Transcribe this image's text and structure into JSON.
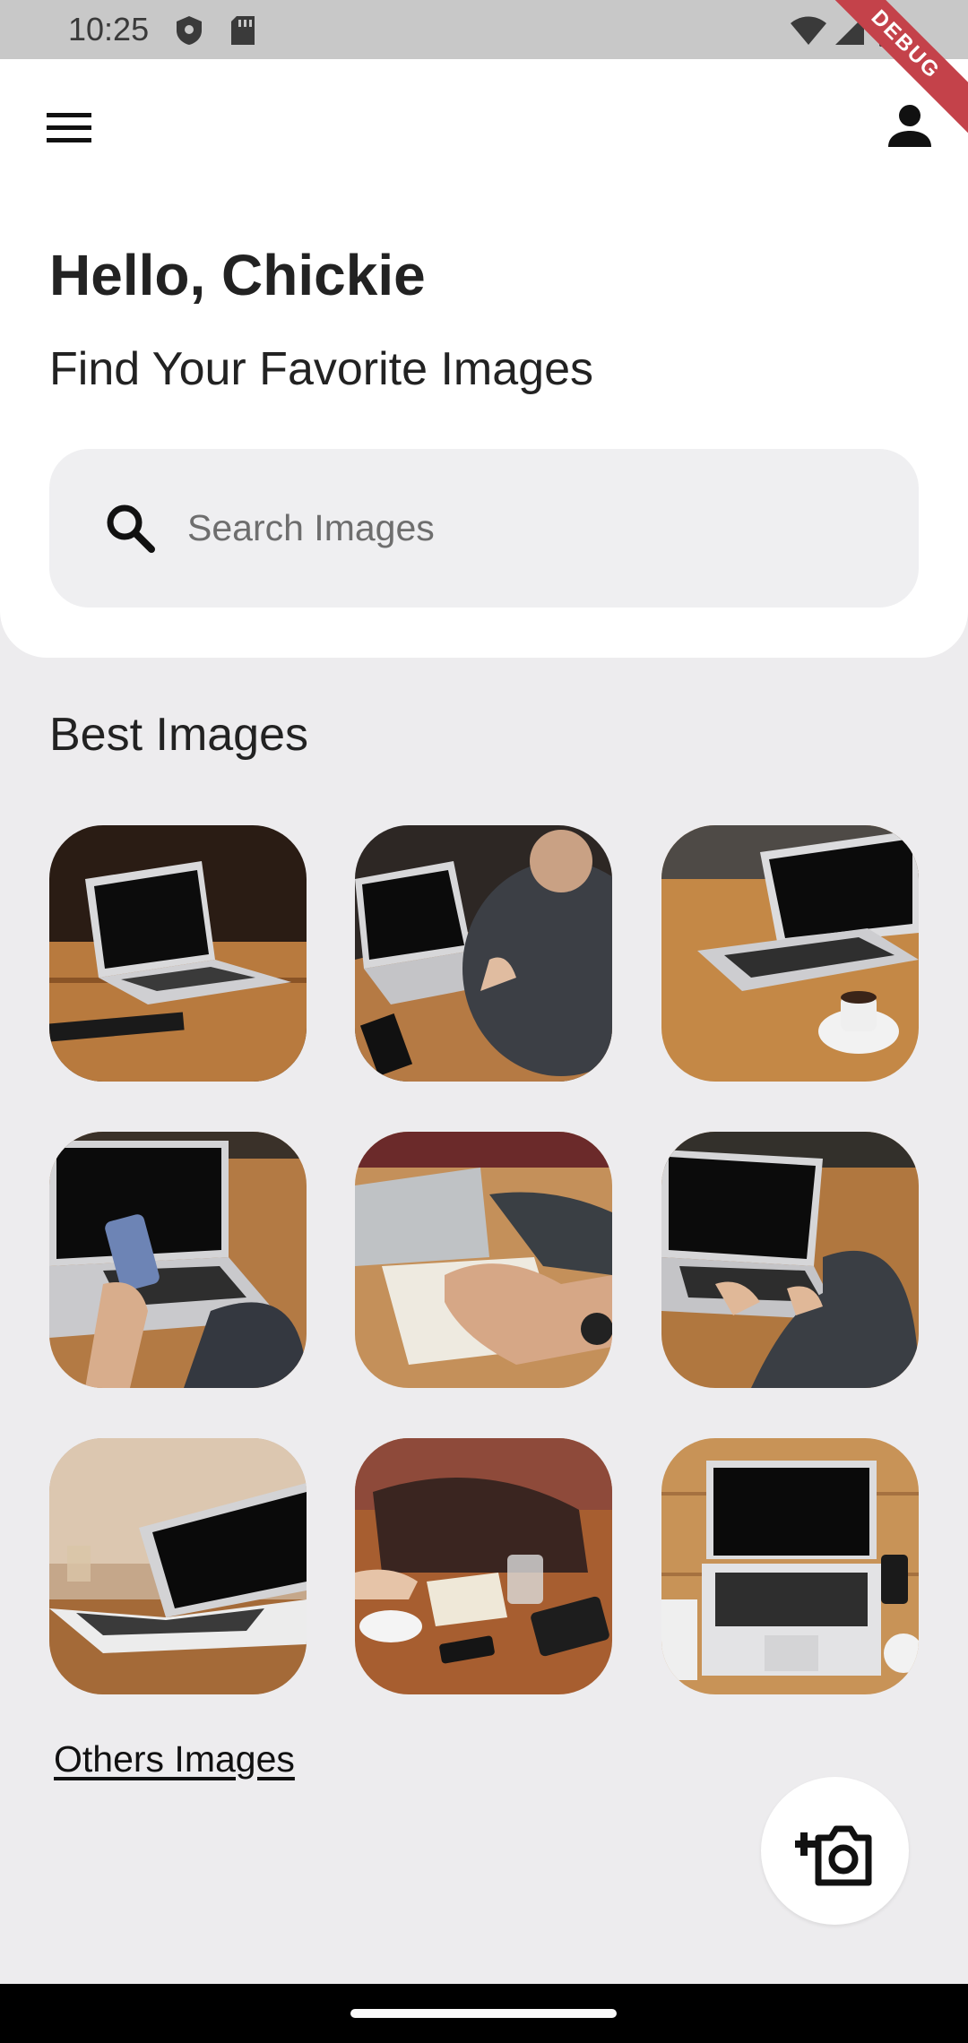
{
  "status_bar": {
    "time": "10:25",
    "debug_label": "DEBUG"
  },
  "header": {
    "greeting": "Hello, Chickie",
    "subtitle": "Find Your Favorite Images"
  },
  "search": {
    "placeholder": "Search Images",
    "value": ""
  },
  "best_images": {
    "title": "Best Images",
    "items": [
      {
        "name": "laptop-on-table"
      },
      {
        "name": "person-typing-laptop"
      },
      {
        "name": "laptop-with-coffee"
      },
      {
        "name": "hands-phone-laptop"
      },
      {
        "name": "hands-writing-notebook"
      },
      {
        "name": "person-typing-laptop-2"
      },
      {
        "name": "laptop-on-desk-light"
      },
      {
        "name": "meeting-table-bag"
      },
      {
        "name": "laptop-top-view"
      }
    ]
  },
  "others_link": "Others Images",
  "icons": {
    "menu": "menu-icon",
    "profile": "person-icon",
    "search": "search-icon",
    "add_photo": "add-a-photo-icon"
  },
  "colors": {
    "background": "#edecee",
    "surface": "#ffffff",
    "search_fill": "#efeff1",
    "text": "#222222",
    "debug_ribbon": "#c4424a"
  }
}
